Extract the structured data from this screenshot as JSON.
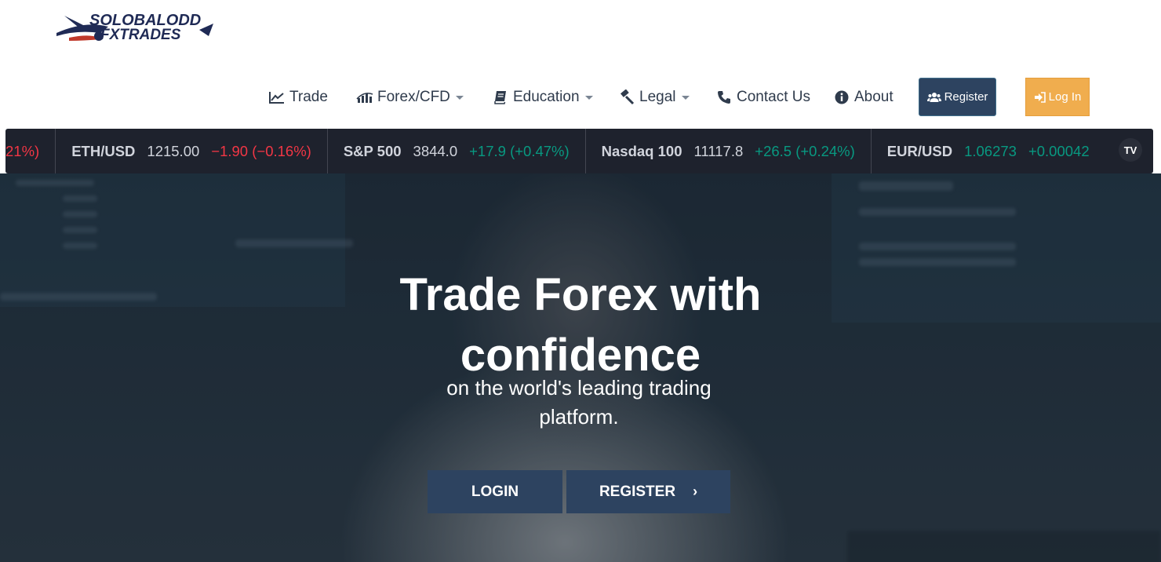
{
  "brand": {
    "logo_line1": "SOLOBALODD",
    "logo_line2": "FXTRADES"
  },
  "nav": {
    "items": [
      {
        "label": "Trade",
        "icon": "chart-line-icon",
        "dropdown": false
      },
      {
        "label": "Forex/CFD",
        "icon": "bar-chart-icon",
        "dropdown": true
      },
      {
        "label": "Education",
        "icon": "book-icon",
        "dropdown": true
      },
      {
        "label": "Legal",
        "icon": "gavel-icon",
        "dropdown": true
      },
      {
        "label": "Contact Us",
        "icon": "phone-icon",
        "dropdown": false
      },
      {
        "label": "About",
        "icon": "info-circle-icon",
        "dropdown": false
      }
    ],
    "register_label": "Register",
    "login_label": "Log In"
  },
  "ticker": {
    "items": [
      {
        "symbol": "",
        "price": "",
        "change": "21%)",
        "direction": "down"
      },
      {
        "symbol": "ETH/USD",
        "price": "1215.00",
        "change": "−1.90 (−0.16%)",
        "direction": "down"
      },
      {
        "symbol": "S&P 500",
        "price": "3844.0",
        "change": "+17.9 (+0.47%)",
        "direction": "up"
      },
      {
        "symbol": "Nasdaq 100",
        "price": "11117.8",
        "change": "+26.5 (+0.24%)",
        "direction": "up"
      },
      {
        "symbol": "EUR/USD",
        "price": "1.06273",
        "change": "+0.00042",
        "direction": "up"
      }
    ],
    "widget_logo": "TV"
  },
  "hero": {
    "title": "Trade Forex with confidence",
    "subtitle": "on the world's leading trading platform.",
    "login_label": "LOGIN",
    "register_label": "REGISTER"
  },
  "colors": {
    "navy": "#2d4360",
    "orange": "#f0ad4e",
    "ticker_bg": "#1e222d",
    "up": "#089981",
    "down": "#f23645"
  }
}
